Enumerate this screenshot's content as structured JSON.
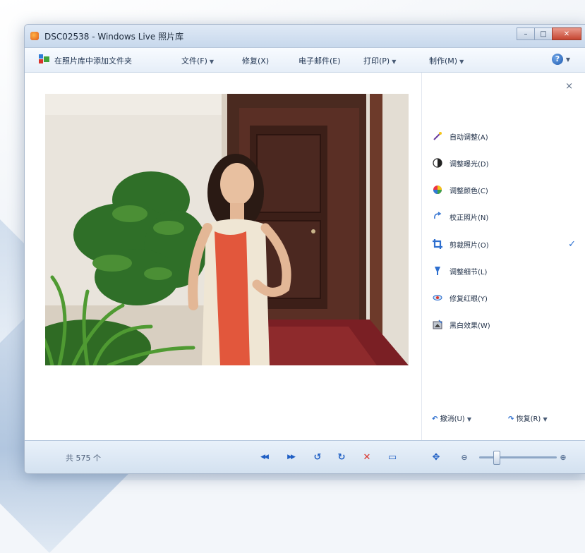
{
  "window": {
    "title": "DSC02538 - Windows Live 照片库",
    "minimize": "–",
    "maximize": "□",
    "close": "✕"
  },
  "menubar": {
    "add_to_gallery": "在照片库中添加文件夹",
    "file": "文件(F)",
    "fix": "修复(X)",
    "email": "电子邮件(E)",
    "print": "打印(P)",
    "make": "制作(M)",
    "help_icon": "help-icon"
  },
  "fix_panel": {
    "close": "×",
    "items": [
      {
        "label": "自动调整(A)",
        "icon": "wand-icon"
      },
      {
        "label": "调整曝光(D)",
        "icon": "exposure-icon"
      },
      {
        "label": "调整颜色(C)",
        "icon": "color-wheel-icon"
      },
      {
        "label": "校正照片(N)",
        "icon": "straighten-icon"
      },
      {
        "label": "剪裁照片(O)",
        "icon": "crop-icon",
        "checked": true
      },
      {
        "label": "调整细节(L)",
        "icon": "detail-icon"
      },
      {
        "label": "修复红眼(Y)",
        "icon": "red-eye-icon"
      },
      {
        "label": "黑白效果(W)",
        "icon": "black-white-icon"
      }
    ],
    "undo": "撤消(U)",
    "revert": "恢复(R)"
  },
  "statusbar": {
    "count": "共 575 个",
    "prev": "◀◀",
    "next": "▶▶",
    "rotate_left": "↺",
    "rotate_right": "↻",
    "delete": "✕",
    "slideshow": "▭",
    "zoom_level": 0.2
  },
  "colors": {
    "accent": "#1f5fc4",
    "delete": "#d9342b",
    "check": "#2a6fd1"
  }
}
